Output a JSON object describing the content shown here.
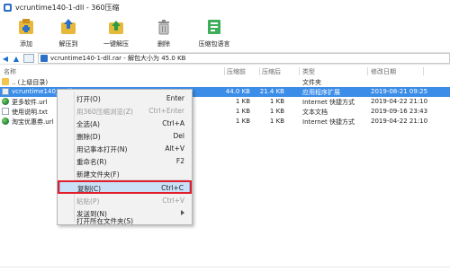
{
  "window": {
    "title": "vcruntime140-1-dll - 360压缩"
  },
  "toolbar": {
    "items": [
      {
        "label": "添加",
        "icon": "add-archive-icon"
      },
      {
        "label": "解压到",
        "icon": "extract-to-icon"
      },
      {
        "label": "一键解压",
        "icon": "one-click-extract-icon"
      },
      {
        "label": "删除",
        "icon": "delete-icon"
      },
      {
        "label": "压缩包语言",
        "icon": "archive-language-icon"
      }
    ]
  },
  "address": {
    "text": "vcruntime140-1-dll.rar - 解包大小为 45.0 KB"
  },
  "columns": {
    "name": "名称",
    "compressed": "压缩前",
    "original": "压缩后",
    "type": "类型",
    "modified": "修改日期"
  },
  "rows": [
    {
      "name": ".. (上级目录)",
      "compressed": "",
      "original": "",
      "type": "文件夹",
      "modified": "",
      "icon": "folder-icon"
    },
    {
      "name": "vcruntime140_1.dll",
      "compressed": "44.0 KB",
      "original": "21.4 KB",
      "type": "应用程序扩展",
      "modified": "2019-08-21 09:25",
      "icon": "dll-file-icon"
    },
    {
      "name": "更多软件.url",
      "compressed": "1 KB",
      "original": "1 KB",
      "type": "Internet 快捷方式",
      "modified": "2019-04-22 21:10",
      "icon": "internet-shortcut-icon"
    },
    {
      "name": "使用说明.txt",
      "compressed": "1 KB",
      "original": "1 KB",
      "type": "文本文档",
      "modified": "2019-09-16 23:43",
      "icon": "text-file-icon"
    },
    {
      "name": "淘宝优惠券.url",
      "compressed": "1 KB",
      "original": "1 KB",
      "type": "Internet 快捷方式",
      "modified": "2019-04-22 21:10",
      "icon": "internet-shortcut-icon"
    }
  ],
  "context_menu": {
    "items": [
      {
        "label": "打开(O)",
        "shortcut": "Enter"
      },
      {
        "label": "用360压缩浏览(Z)",
        "shortcut": "Ctrl+Enter",
        "disabled": true
      },
      {
        "label": "全选(A)",
        "shortcut": "Ctrl+A"
      },
      {
        "label": "删除(D)",
        "shortcut": "Del"
      },
      {
        "label": "用记事本打开(N)",
        "shortcut": "Alt+V"
      },
      {
        "label": "重命名(R)",
        "shortcut": "F2"
      },
      {
        "label": "新建文件夹(F)",
        "shortcut": ""
      },
      {
        "label": "复制(C)",
        "shortcut": "Ctrl+C",
        "highlighted": true
      },
      {
        "label": "粘贴(P)",
        "shortcut": "Ctrl+V",
        "disabled": true
      },
      {
        "label": "发送到(N)",
        "shortcut": "",
        "submenu": true
      },
      {
        "label": "打开所在文件夹(S)",
        "shortcut": ""
      }
    ]
  },
  "colors": {
    "selection": "#3b8de8",
    "highlight_border": "#e21e2b",
    "accent": "#2b6fc7"
  }
}
